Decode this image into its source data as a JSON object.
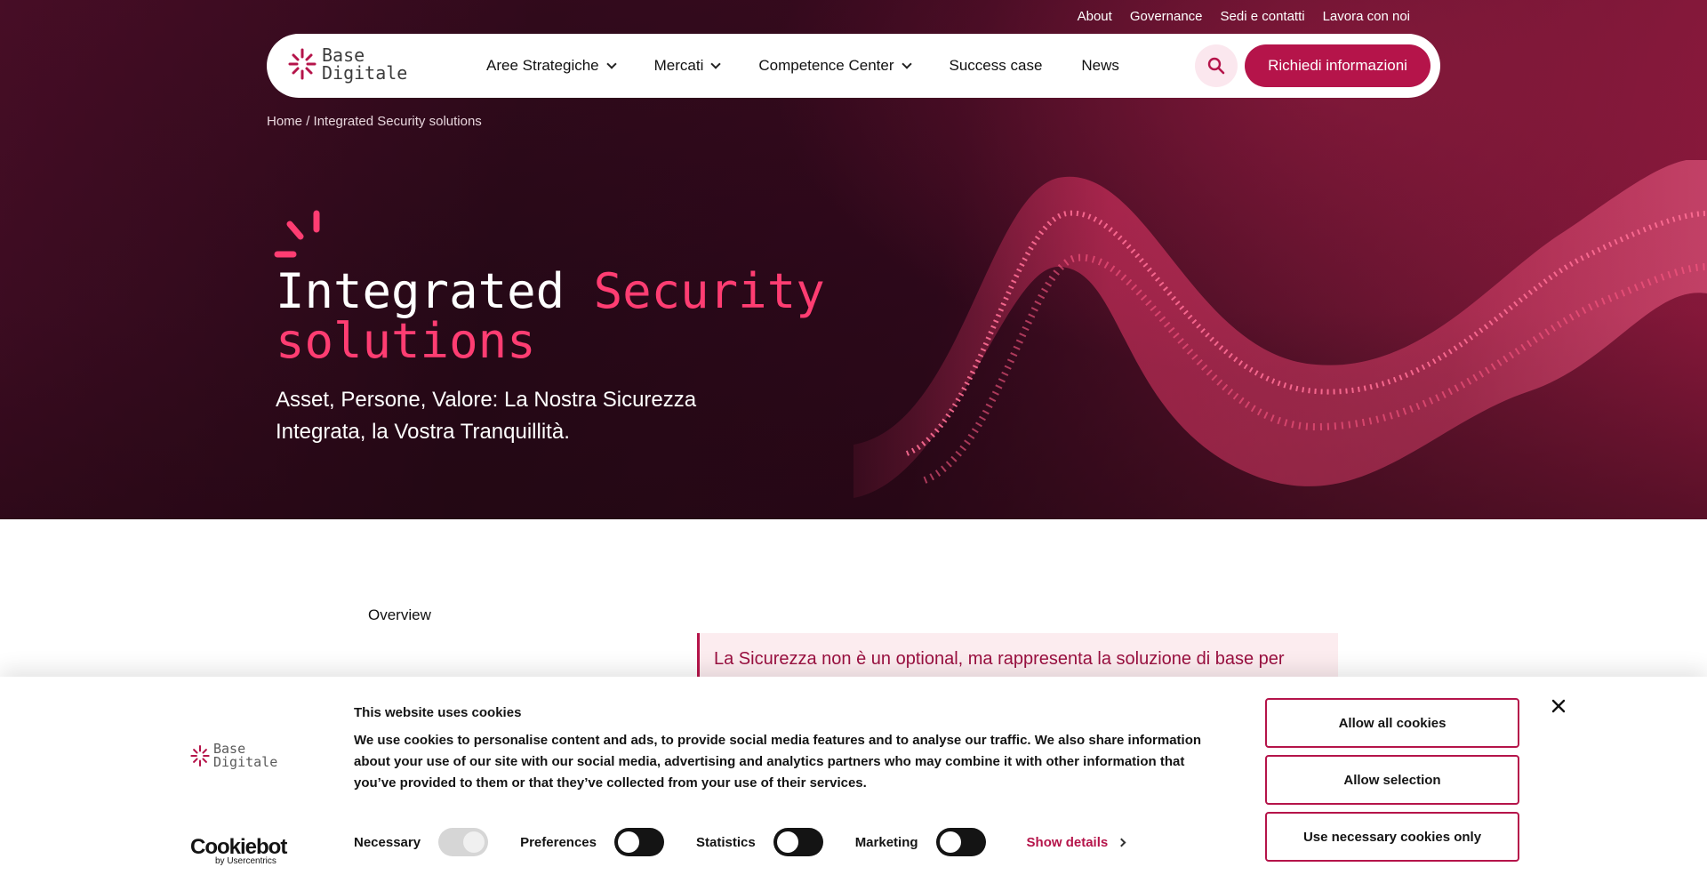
{
  "colors": {
    "brand": "#b5144a",
    "accent_pink": "#ff3d72",
    "hero_dark": "#2b0a1a"
  },
  "top_links": [
    "About",
    "Governance",
    "Sedi e contatti",
    "Lavora con noi"
  ],
  "logo": {
    "line1": "Base",
    "line2": "Digitale"
  },
  "nav": {
    "items": [
      {
        "label": "Aree Strategiche",
        "dropdown": true
      },
      {
        "label": "Mercati",
        "dropdown": true
      },
      {
        "label": "Competence Center",
        "dropdown": true
      },
      {
        "label": "Success case",
        "dropdown": false
      },
      {
        "label": "News",
        "dropdown": false
      }
    ],
    "search_icon": "search-icon",
    "cta_label": "Richiedi informazioni"
  },
  "breadcrumb": {
    "home": "Home",
    "separator": "/",
    "current": "Integrated Security solutions"
  },
  "hero": {
    "title_white": "Integrated",
    "title_pink_1": "Security",
    "title_pink_2": "solutions",
    "subtitle": "Asset, Persone, Valore: La Nostra Sicurezza Integrata, la Vostra Tranquillità."
  },
  "content": {
    "overview_label": "Overview",
    "quote": "La Sicurezza non è un optional, ma rappresenta la soluzione di base per"
  },
  "cookie_banner": {
    "title": "This website uses cookies",
    "text": "We use cookies to personalise content and ads, to provide social media features and to analyse our traffic. We also share information about your use of our site with our social media, advertising and analytics partners who may combine it with other information that you’ve provided to them or that they’ve collected from your use of their services.",
    "toggles": [
      {
        "label": "Necessary",
        "state": "on-disabled"
      },
      {
        "label": "Preferences",
        "state": "off"
      },
      {
        "label": "Statistics",
        "state": "off"
      },
      {
        "label": "Marketing",
        "state": "off"
      }
    ],
    "show_details": "Show details",
    "buttons": {
      "allow_all": "Allow all cookies",
      "allow_selection": "Allow selection",
      "necessary_only": "Use necessary cookies only"
    },
    "brand": {
      "name": "Cookiebot",
      "by": "by Usercentrics"
    }
  }
}
